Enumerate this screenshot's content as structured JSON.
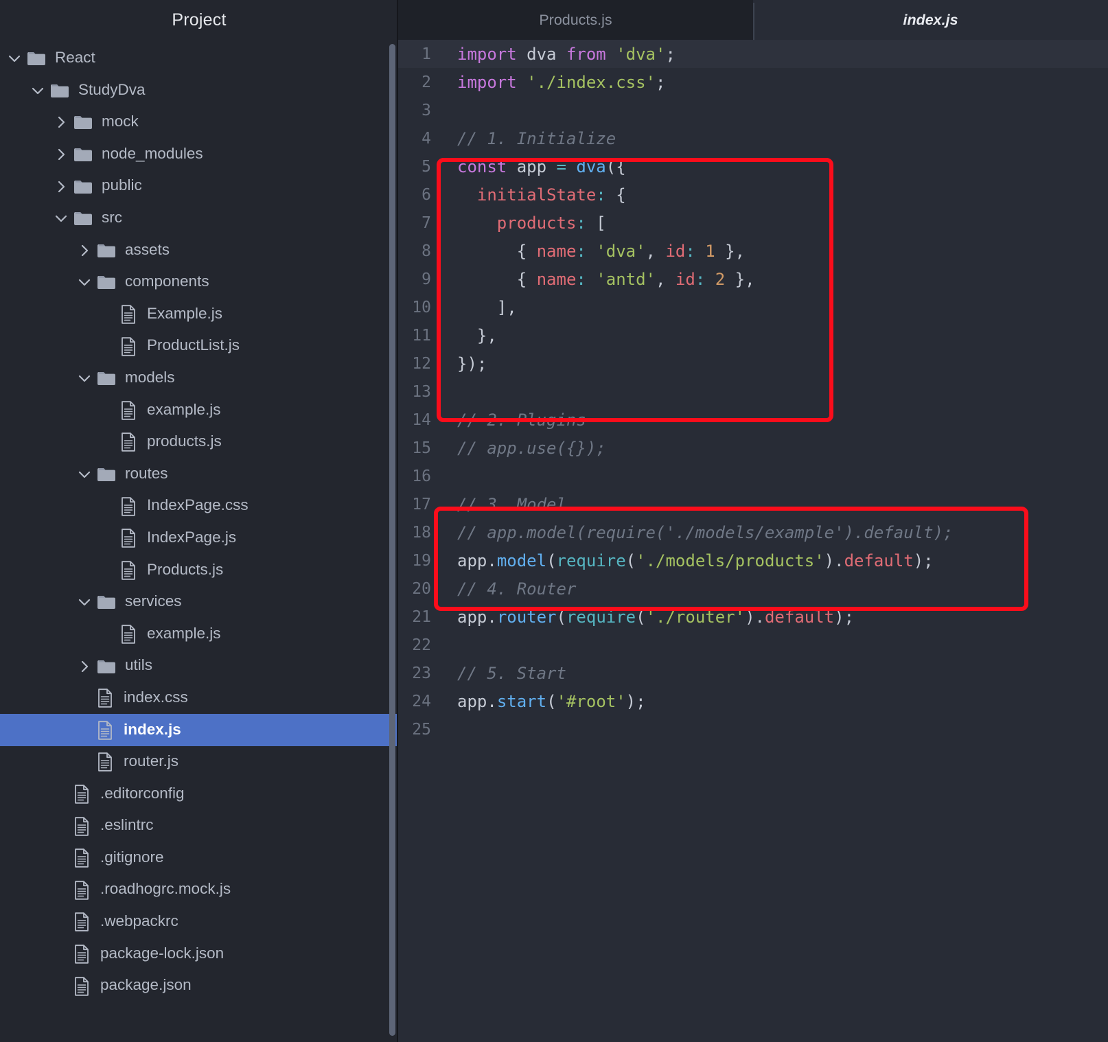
{
  "sidebar": {
    "title": "Project",
    "tree": [
      {
        "label": "React",
        "type": "folder",
        "depth": 0,
        "state": "expanded"
      },
      {
        "label": "StudyDva",
        "type": "folder",
        "depth": 1,
        "state": "expanded"
      },
      {
        "label": "mock",
        "type": "folder",
        "depth": 2,
        "state": "collapsed"
      },
      {
        "label": "node_modules",
        "type": "folder",
        "depth": 2,
        "state": "collapsed"
      },
      {
        "label": "public",
        "type": "folder",
        "depth": 2,
        "state": "collapsed"
      },
      {
        "label": "src",
        "type": "folder",
        "depth": 2,
        "state": "expanded"
      },
      {
        "label": "assets",
        "type": "folder",
        "depth": 3,
        "state": "collapsed"
      },
      {
        "label": "components",
        "type": "folder",
        "depth": 3,
        "state": "expanded"
      },
      {
        "label": "Example.js",
        "type": "file",
        "depth": 4,
        "state": "none"
      },
      {
        "label": "ProductList.js",
        "type": "file",
        "depth": 4,
        "state": "none"
      },
      {
        "label": "models",
        "type": "folder",
        "depth": 3,
        "state": "expanded"
      },
      {
        "label": "example.js",
        "type": "file",
        "depth": 4,
        "state": "none"
      },
      {
        "label": "products.js",
        "type": "file",
        "depth": 4,
        "state": "none"
      },
      {
        "label": "routes",
        "type": "folder",
        "depth": 3,
        "state": "expanded"
      },
      {
        "label": "IndexPage.css",
        "type": "file",
        "depth": 4,
        "state": "none"
      },
      {
        "label": "IndexPage.js",
        "type": "file",
        "depth": 4,
        "state": "none"
      },
      {
        "label": "Products.js",
        "type": "file",
        "depth": 4,
        "state": "none"
      },
      {
        "label": "services",
        "type": "folder",
        "depth": 3,
        "state": "expanded"
      },
      {
        "label": "example.js",
        "type": "file",
        "depth": 4,
        "state": "none"
      },
      {
        "label": "utils",
        "type": "folder",
        "depth": 3,
        "state": "collapsed"
      },
      {
        "label": "index.css",
        "type": "file",
        "depth": 3,
        "state": "none"
      },
      {
        "label": "index.js",
        "type": "file",
        "depth": 3,
        "state": "none",
        "selected": true
      },
      {
        "label": "router.js",
        "type": "file",
        "depth": 3,
        "state": "none"
      },
      {
        "label": ".editorconfig",
        "type": "file",
        "depth": 2,
        "state": "none"
      },
      {
        "label": ".eslintrc",
        "type": "file",
        "depth": 2,
        "state": "none"
      },
      {
        "label": ".gitignore",
        "type": "file",
        "depth": 2,
        "state": "none"
      },
      {
        "label": ".roadhogrc.mock.js",
        "type": "file",
        "depth": 2,
        "state": "none"
      },
      {
        "label": ".webpackrc",
        "type": "file",
        "depth": 2,
        "state": "none"
      },
      {
        "label": "package-lock.json",
        "type": "file",
        "depth": 2,
        "state": "none"
      },
      {
        "label": "package.json",
        "type": "file",
        "depth": 2,
        "state": "none"
      }
    ]
  },
  "editor": {
    "tabs": [
      {
        "label": "Products.js",
        "active": false
      },
      {
        "label": "index.js",
        "active": true
      }
    ],
    "lines": [
      {
        "n": "1",
        "current": true,
        "tokens": [
          {
            "t": "import",
            "c": "k"
          },
          {
            "t": " dva ",
            "c": "id"
          },
          {
            "t": "from",
            "c": "k"
          },
          {
            "t": " ",
            "c": "pun"
          },
          {
            "t": "'dva'",
            "c": "str"
          },
          {
            "t": ";",
            "c": "pun"
          }
        ]
      },
      {
        "n": "2",
        "current": false,
        "tokens": [
          {
            "t": "import",
            "c": "k"
          },
          {
            "t": " ",
            "c": "pun"
          },
          {
            "t": "'./index.css'",
            "c": "str"
          },
          {
            "t": ";",
            "c": "pun"
          }
        ]
      },
      {
        "n": "3",
        "current": false,
        "tokens": []
      },
      {
        "n": "4",
        "current": false,
        "tokens": [
          {
            "t": "// 1. Initialize",
            "c": "cmt"
          }
        ]
      },
      {
        "n": "5",
        "current": false,
        "tokens": [
          {
            "t": "const",
            "c": "k"
          },
          {
            "t": " app ",
            "c": "id"
          },
          {
            "t": "=",
            "c": "op"
          },
          {
            "t": " ",
            "c": "pun"
          },
          {
            "t": "dva",
            "c": "fn"
          },
          {
            "t": "({",
            "c": "pun"
          }
        ]
      },
      {
        "n": "6",
        "current": false,
        "tokens": [
          {
            "t": "  ",
            "c": "pun"
          },
          {
            "t": "initialState",
            "c": "prop"
          },
          {
            "t": ":",
            "c": "op"
          },
          {
            "t": " {",
            "c": "pun"
          }
        ]
      },
      {
        "n": "7",
        "current": false,
        "tokens": [
          {
            "t": "    ",
            "c": "pun"
          },
          {
            "t": "products",
            "c": "prop"
          },
          {
            "t": ":",
            "c": "op"
          },
          {
            "t": " [",
            "c": "pun"
          }
        ]
      },
      {
        "n": "8",
        "current": false,
        "tokens": [
          {
            "t": "      { ",
            "c": "pun"
          },
          {
            "t": "name",
            "c": "prop"
          },
          {
            "t": ":",
            "c": "op"
          },
          {
            "t": " ",
            "c": "pun"
          },
          {
            "t": "'dva'",
            "c": "str"
          },
          {
            "t": ", ",
            "c": "pun"
          },
          {
            "t": "id",
            "c": "prop"
          },
          {
            "t": ":",
            "c": "op"
          },
          {
            "t": " ",
            "c": "pun"
          },
          {
            "t": "1",
            "c": "num"
          },
          {
            "t": " },",
            "c": "pun"
          }
        ]
      },
      {
        "n": "9",
        "current": false,
        "tokens": [
          {
            "t": "      { ",
            "c": "pun"
          },
          {
            "t": "name",
            "c": "prop"
          },
          {
            "t": ":",
            "c": "op"
          },
          {
            "t": " ",
            "c": "pun"
          },
          {
            "t": "'antd'",
            "c": "str"
          },
          {
            "t": ", ",
            "c": "pun"
          },
          {
            "t": "id",
            "c": "prop"
          },
          {
            "t": ":",
            "c": "op"
          },
          {
            "t": " ",
            "c": "pun"
          },
          {
            "t": "2",
            "c": "num"
          },
          {
            "t": " },",
            "c": "pun"
          }
        ]
      },
      {
        "n": "10",
        "current": false,
        "tokens": [
          {
            "t": "    ],",
            "c": "pun"
          }
        ]
      },
      {
        "n": "11",
        "current": false,
        "tokens": [
          {
            "t": "  },",
            "c": "pun"
          }
        ]
      },
      {
        "n": "12",
        "current": false,
        "tokens": [
          {
            "t": "});",
            "c": "pun"
          }
        ]
      },
      {
        "n": "13",
        "current": false,
        "tokens": []
      },
      {
        "n": "14",
        "current": false,
        "tokens": [
          {
            "t": "// 2. Plugins",
            "c": "cmt"
          }
        ]
      },
      {
        "n": "15",
        "current": false,
        "tokens": [
          {
            "t": "// app.use({});",
            "c": "cmt"
          }
        ]
      },
      {
        "n": "16",
        "current": false,
        "tokens": []
      },
      {
        "n": "17",
        "current": false,
        "tokens": [
          {
            "t": "// 3. Model",
            "c": "cmt"
          }
        ]
      },
      {
        "n": "18",
        "current": false,
        "tokens": [
          {
            "t": "// app.model(require('./models/example').default);",
            "c": "cmt"
          }
        ]
      },
      {
        "n": "19",
        "current": false,
        "tokens": [
          {
            "t": "app",
            "c": "id"
          },
          {
            "t": ".",
            "c": "pun"
          },
          {
            "t": "model",
            "c": "fn"
          },
          {
            "t": "(",
            "c": "pun"
          },
          {
            "t": "require",
            "c": "call"
          },
          {
            "t": "(",
            "c": "pun"
          },
          {
            "t": "'./models/products'",
            "c": "str"
          },
          {
            "t": ")",
            "c": "pun"
          },
          {
            "t": ".",
            "c": "pun"
          },
          {
            "t": "default",
            "c": "prop"
          },
          {
            "t": ");",
            "c": "pun"
          }
        ]
      },
      {
        "n": "20",
        "current": false,
        "tokens": [
          {
            "t": "// 4. Router",
            "c": "cmt"
          }
        ]
      },
      {
        "n": "21",
        "current": false,
        "tokens": [
          {
            "t": "app",
            "c": "id"
          },
          {
            "t": ".",
            "c": "pun"
          },
          {
            "t": "router",
            "c": "fn"
          },
          {
            "t": "(",
            "c": "pun"
          },
          {
            "t": "require",
            "c": "call"
          },
          {
            "t": "(",
            "c": "pun"
          },
          {
            "t": "'./router'",
            "c": "str"
          },
          {
            "t": ")",
            "c": "pun"
          },
          {
            "t": ".",
            "c": "pun"
          },
          {
            "t": "default",
            "c": "prop"
          },
          {
            "t": ");",
            "c": "pun"
          }
        ]
      },
      {
        "n": "22",
        "current": false,
        "tokens": []
      },
      {
        "n": "23",
        "current": false,
        "tokens": [
          {
            "t": "// 5. Start",
            "c": "cmt"
          }
        ]
      },
      {
        "n": "24",
        "current": false,
        "tokens": [
          {
            "t": "app",
            "c": "id"
          },
          {
            "t": ".",
            "c": "pun"
          },
          {
            "t": "start",
            "c": "fn"
          },
          {
            "t": "(",
            "c": "pun"
          },
          {
            "t": "'#root'",
            "c": "str"
          },
          {
            "t": ");",
            "c": "pun"
          }
        ]
      },
      {
        "n": "25",
        "current": false,
        "tokens": []
      }
    ],
    "annotations": [
      {
        "id": "redbox-1",
        "covers_lines": "4-12",
        "color": "#fb0d1b"
      },
      {
        "id": "redbox-2",
        "covers_lines": "16-19",
        "color": "#fb0d1b"
      }
    ]
  },
  "colors": {
    "sidebar_bg": "#23262e",
    "editor_bg": "#282c36",
    "tab_inactive_bg": "#1e2128",
    "selection_blue": "#4d71c6",
    "annotation_red": "#fb0d1b"
  }
}
